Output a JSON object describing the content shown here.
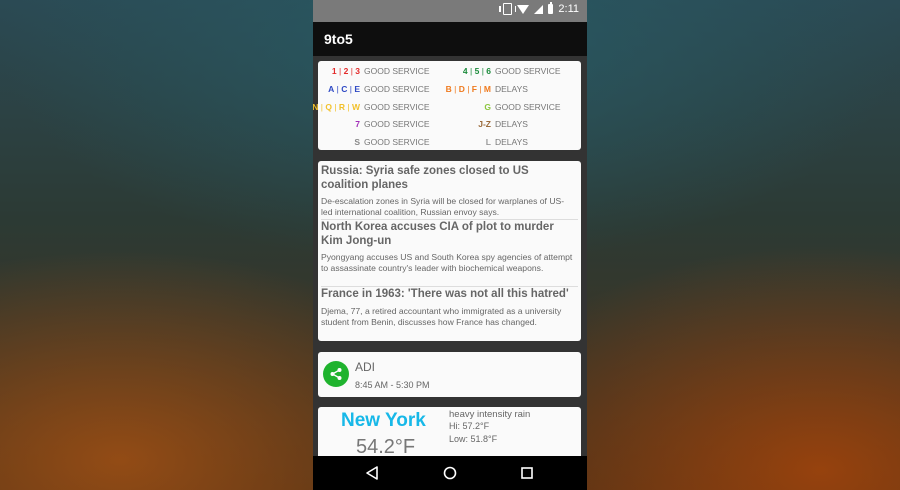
{
  "status_bar": {
    "time": "2:11",
    "icons": [
      "vibrate-icon",
      "wifi-icon",
      "signal-icon",
      "battery-icon"
    ]
  },
  "app": {
    "title": "9to5"
  },
  "subway": {
    "left": [
      {
        "lines": [
          "1",
          "2",
          "3"
        ],
        "colors": [
          "#e32b2b",
          "#e32b2b",
          "#e32b2b"
        ],
        "status": "GOOD SERVICE"
      },
      {
        "lines": [
          "A",
          "C",
          "E"
        ],
        "colors": [
          "#2e49c4",
          "#2e49c4",
          "#2e49c4"
        ],
        "status": "GOOD SERVICE"
      },
      {
        "lines": [
          "N",
          "Q",
          "R",
          "W"
        ],
        "colors": [
          "#f2c12b",
          "#f2c12b",
          "#f2c12b",
          "#f2c12b"
        ],
        "status": "GOOD SERVICE"
      },
      {
        "lines": [
          "7"
        ],
        "colors": [
          "#a12fb8"
        ],
        "status": "GOOD SERVICE"
      },
      {
        "lines": [
          "S"
        ],
        "colors": [
          "#888888"
        ],
        "status": "GOOD SERVICE"
      }
    ],
    "right": [
      {
        "lines": [
          "4",
          "5",
          "6"
        ],
        "colors": [
          "#1a8a3a",
          "#1a8a3a",
          "#1a8a3a"
        ],
        "status": "GOOD SERVICE"
      },
      {
        "lines": [
          "B",
          "D",
          "F",
          "M"
        ],
        "colors": [
          "#ef7a1e",
          "#ef7a1e",
          "#ef7a1e",
          "#ef7a1e"
        ],
        "status": "DELAYS"
      },
      {
        "lines": [
          "G"
        ],
        "colors": [
          "#8cc63f"
        ],
        "status": "GOOD SERVICE"
      },
      {
        "lines": [
          "J-Z"
        ],
        "colors": [
          "#9a6a3a"
        ],
        "status": "DELAYS"
      },
      {
        "lines": [
          "L"
        ],
        "colors": [
          "#999999"
        ],
        "status": "DELAYS"
      }
    ]
  },
  "news": [
    {
      "headline": "Russia: Syria safe zones closed to US coalition planes",
      "description": "De-escalation zones in Syria will be closed for warplanes of US-led international coalition, Russian envoy says."
    },
    {
      "headline": "North Korea accuses CIA of plot to murder Kim Jong-un",
      "description": "Pyongyang accuses US and South Korea spy agencies of attempt to assassinate country's leader with biochemical weapons."
    },
    {
      "headline": "France in 1963: 'There was not all this hatred'",
      "description": "Djema, 77, a retired accountant who immigrated as a university student from Benin, discusses how France has changed."
    }
  ],
  "calendar": {
    "icon": "share-icon",
    "name": "ADI",
    "time": "8:45 AM - 5:30 PM",
    "icon_color": "#1fb32e"
  },
  "weather": {
    "city": "New York",
    "temp": "54.2°F",
    "condition": "heavy intensity rain",
    "hi": "Hi: 57.2°F",
    "lo": "Low: 51.8°F",
    "city_color": "#17b8e8"
  },
  "nav": {
    "back": "back-icon",
    "home": "home-icon",
    "recents": "recents-icon"
  }
}
